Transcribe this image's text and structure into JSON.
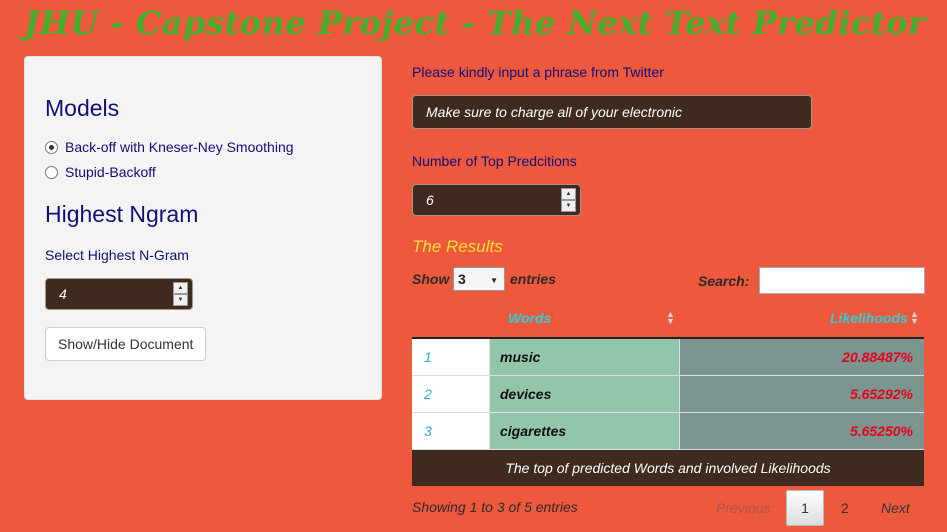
{
  "app": {
    "title": "JHU - Capstone Project - The Next Text Predictor"
  },
  "sidebar": {
    "models_heading": "Models",
    "model_options": [
      {
        "label": "Back-off with Kneser-Ney Smoothing",
        "selected": true
      },
      {
        "label": "Stupid-Backoff",
        "selected": false
      }
    ],
    "ngram_heading": "Highest Ngram",
    "ngram_label": "Select Highest N-Gram",
    "ngram_value": "4",
    "doc_button": "Show/Hide Document"
  },
  "main": {
    "phrase_label": "Please kindly input a phrase from Twitter",
    "phrase_value": "Make sure to charge all of your electronic",
    "top_label": "Number of Top Predcitions",
    "top_value": "6",
    "results_title": "The Results"
  },
  "table": {
    "show_label": "Show",
    "entries_value": "3",
    "entries_label": "entries",
    "search_label": "Search:",
    "columns": [
      "Words",
      "Likelihoods"
    ],
    "rows": [
      {
        "idx": "1",
        "word": "music",
        "likelihood": "20.88487%"
      },
      {
        "idx": "2",
        "word": "devices",
        "likelihood": "5.65292%"
      },
      {
        "idx": "3",
        "word": "cigarettes",
        "likelihood": "5.65250%"
      }
    ],
    "caption": "The top of predicted Words and involved Likelihoods",
    "info": "Showing 1 to 3 of 5 entries",
    "pager": {
      "previous": "Previous",
      "current": "1",
      "page2": "2",
      "next": "Next"
    }
  },
  "colors": {
    "background": "#ee583d",
    "title": "#42b02b",
    "input_bg": "#3e2a1f",
    "results_title": "#f7df3a",
    "header_text": "#2bd0d8",
    "likelihood_text": "#e5001b"
  },
  "icons": [
    "radio-checked-icon",
    "radio-unchecked-icon",
    "spinner-up-icon",
    "spinner-down-icon",
    "select-caret-icon",
    "sort-icon"
  ]
}
